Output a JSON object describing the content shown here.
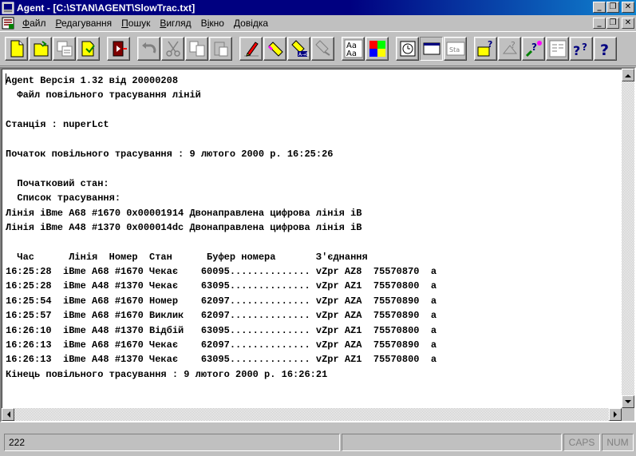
{
  "window": {
    "title": "Agent - [C:\\STAN\\AGENT\\SlowTrac.txt]"
  },
  "menu": [
    {
      "label": "Файл",
      "mnemonic": "Ф",
      "rest": "айл"
    },
    {
      "label": "Редагування",
      "mnemonic": "Р",
      "rest": "едагування"
    },
    {
      "label": "Пошук",
      "mnemonic": "П",
      "rest": "ошук"
    },
    {
      "label": "Вигляд",
      "mnemonic": "В",
      "rest": "игляд"
    },
    {
      "label": "Вікно",
      "mnemonic": "і",
      "pre": "В",
      "rest": "кно"
    },
    {
      "label": "Довідка",
      "mnemonic": "",
      "pre": "Довідка",
      "rest": ""
    }
  ],
  "toolbar": {
    "font_button_label": "Aa",
    "settings_button_label": "Sta",
    "icons": [
      "new-file-icon",
      "open-file-icon",
      "copy-window-icon",
      "paste-window-icon",
      "exit-door-icon",
      "undo-icon",
      "cut-icon",
      "copy-icon",
      "paste-icon",
      "eraser-icon",
      "marker-icon",
      "find-icon",
      "replace-icon",
      "find-next-icon",
      "font-icon",
      "color-icon",
      "clock-icon",
      "window-icon",
      "settings-icon",
      "terminal-help-icon",
      "context-help-icon",
      "help-icon",
      "about-icon",
      "what-icon",
      "question-icon"
    ]
  },
  "document": {
    "lines": [
      "Agent Версія 1.32 від 20000208",
      "  Файл повільного трасування ліній",
      "",
      "Станція : nuperLct",
      "",
      "Початок повільного трасування : 9 лютого 2000 р. 16:25:26",
      "",
      "  Початковий стан:",
      "  Список трасування:",
      "Лінія iBme A68 #1670 0x00001914 Двонаправлена цифрова лінія iB",
      "Лінія iBme A48 #1370 0x000014dc Двонаправлена цифрова лінія iB",
      "",
      "  Час      Лінія  Номер  Стан      Буфер номера       З'єднання",
      "16:25:28  iBme A68 #1670 Чекає    60095.............. vZpr AZ8  75570870  a",
      "16:25:28  iBme A48 #1370 Чекає    63095.............. vZpr AZ1  75570800  a",
      "16:25:54  iBme A68 #1670 Номер    62097.............. vZpr AZA  75570890  a",
      "16:25:57  iBme A68 #1670 Виклик   62097.............. vZpr AZA  75570890  a",
      "16:26:10  iBme A48 #1370 Відбій   63095.............. vZpr AZ1  75570800  a",
      "16:26:13  iBme A68 #1670 Чекає    62097.............. vZpr AZA  75570890  a",
      "16:26:13  iBme A48 #1370 Чекає    63095.............. vZpr AZ1  75570800  a",
      "Кінець повільного трасування : 9 лютого 2000 р. 16:26:21"
    ]
  },
  "status": {
    "line": "222",
    "caps": "CAPS",
    "num": "NUM"
  }
}
